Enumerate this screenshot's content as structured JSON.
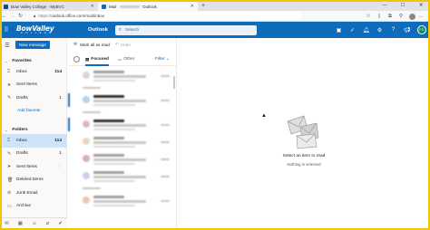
{
  "browser": {
    "tabs": [
      {
        "label": "Bow Valley College - MyBVC",
        "active": false,
        "favicon_color": "#1e3f8c"
      },
      {
        "label_prefix": "Mail",
        "label_suffix": "Outlook",
        "active": true,
        "favicon_color": "#0f6cbd"
      }
    ],
    "new_tab": "+",
    "url_prefix": "https://",
    "url_main": "outlook.office.com/mail/inbox",
    "window_controls": [
      "—",
      "☐",
      "✕"
    ]
  },
  "outlook_header": {
    "logo_main": "BowValley",
    "logo_sub": "C O L L E G E",
    "app_name": "Outlook",
    "search_placeholder": "Search",
    "avatar_initials": "FG",
    "colors": {
      "header": "#0f6cbd",
      "avatar": "#0b8a5a"
    }
  },
  "sidebar": {
    "new_message": "New message",
    "favorites_heading": "Favorites",
    "favorites": [
      {
        "label": "Inbox",
        "count": "114",
        "icon": "inbox-icon"
      },
      {
        "label": "Sent Items",
        "count": "",
        "icon": "sent-icon"
      },
      {
        "label": "Drafts",
        "count": "1",
        "icon": "drafts-icon"
      }
    ],
    "add_favorite": "Add favorite",
    "folders_heading": "Folders",
    "folders": [
      {
        "label": "Inbox",
        "count": "114",
        "icon": "inbox-icon",
        "active": true
      },
      {
        "label": "Drafts",
        "count": "1",
        "icon": "drafts-icon"
      },
      {
        "label": "Sent Items",
        "count": "",
        "icon": "sent-icon"
      },
      {
        "label": "Deleted Items",
        "count": "",
        "icon": "trash-icon"
      },
      {
        "label": "Junk Email",
        "count": "",
        "icon": "junk-icon"
      },
      {
        "label": "Archive",
        "count": "",
        "icon": "archive-icon"
      }
    ],
    "bottom_icons": [
      "mail-icon",
      "calendar-icon",
      "people-icon",
      "attach-icon",
      "tasks-icon"
    ]
  },
  "message_list": {
    "mark_all_read": "Mark all as read",
    "undo": "Undo",
    "tabs": [
      "Focused",
      "Other"
    ],
    "filter": "Filter",
    "row_dot_colors": [
      "#e3d3c8",
      "#b3d4ef",
      "#e0b8b8",
      "#e8d5c2",
      "#d8b0b0",
      "#d7c9e8",
      "#e9c7b7"
    ]
  },
  "reading_pane": {
    "title": "Select an item to read",
    "subtitle": "Nothing is selected"
  }
}
